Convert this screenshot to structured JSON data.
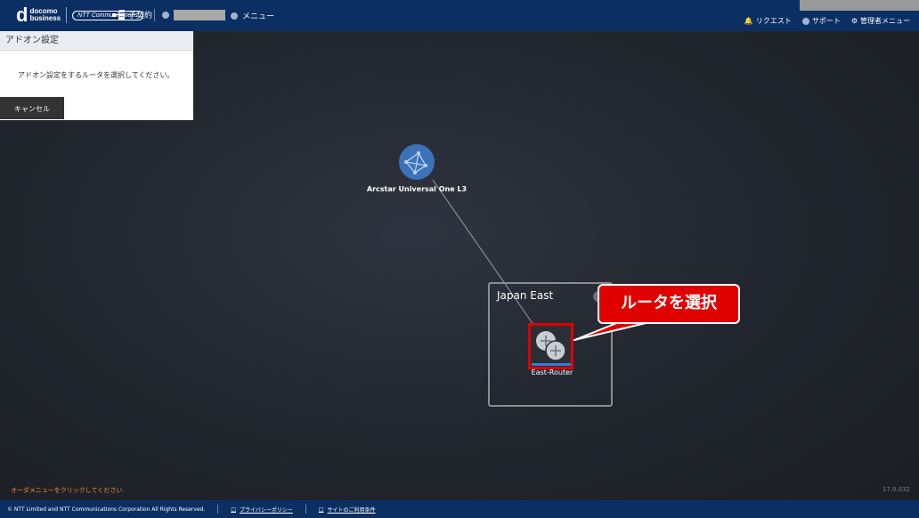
{
  "header": {
    "logo_letter": "d",
    "logo_line1": "docomo",
    "logo_line2": "business",
    "partner_logo": "NTT Communications",
    "contract_label": "子契約",
    "menu_label": "メニュー",
    "right_links": [
      {
        "icon": "bell-icon",
        "label": "リクエスト"
      },
      {
        "icon": "help-icon",
        "label": "サポート"
      },
      {
        "icon": "gear-icon",
        "label": "管理者メニュー"
      }
    ]
  },
  "panel": {
    "title": "アドオン設定",
    "message": "アドオン設定をするルータを選択してください。",
    "cancel_label": "キャンセル"
  },
  "topology": {
    "cloud_label": "Arcstar Universal One L3",
    "region_title": "Japan East",
    "router_label": "East-Router"
  },
  "callout": {
    "text": "ルータを選択"
  },
  "hint_text": "オーダメニューをクリックしてください",
  "version": "17.0.032",
  "footer": {
    "copyright": "© NTT Limited and NTT Communications Corporation All Rights Reserved.",
    "privacy_label": "プライバシーポリシー",
    "terms_label": "サイトのご利用条件"
  },
  "colors": {
    "header_bg": "#0b2f63",
    "highlight": "#e00000",
    "cloud": "#3b72b9",
    "hint": "#ff8a3d"
  }
}
